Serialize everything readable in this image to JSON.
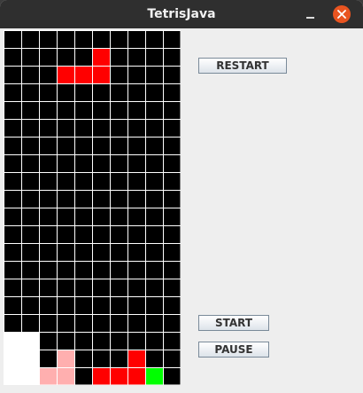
{
  "window": {
    "title": "TetrisJava"
  },
  "buttons": {
    "restart": "RESTART",
    "start": "START",
    "pause": "PAUSE"
  },
  "board": {
    "columns": 10,
    "rows": 20,
    "empty_color": "#000000",
    "grid_color": "#ffffff",
    "cells": [
      {
        "col": 5,
        "row": 1,
        "color": "#ff0000"
      },
      {
        "col": 3,
        "row": 2,
        "color": "#ff0000"
      },
      {
        "col": 4,
        "row": 2,
        "color": "#ff0000"
      },
      {
        "col": 5,
        "row": 2,
        "color": "#ff0000"
      },
      {
        "col": 0,
        "row": 17,
        "color": "#ffffff"
      },
      {
        "col": 1,
        "row": 17,
        "color": "#ffffff"
      },
      {
        "col": 0,
        "row": 18,
        "color": "#ffffff"
      },
      {
        "col": 1,
        "row": 18,
        "color": "#ffffff"
      },
      {
        "col": 3,
        "row": 18,
        "color": "#ffafaf"
      },
      {
        "col": 7,
        "row": 18,
        "color": "#ff0000"
      },
      {
        "col": 0,
        "row": 19,
        "color": "#ffffff"
      },
      {
        "col": 1,
        "row": 19,
        "color": "#ffffff"
      },
      {
        "col": 2,
        "row": 19,
        "color": "#ffafaf"
      },
      {
        "col": 3,
        "row": 19,
        "color": "#ffafaf"
      },
      {
        "col": 5,
        "row": 19,
        "color": "#ff0000"
      },
      {
        "col": 6,
        "row": 19,
        "color": "#ff0000"
      },
      {
        "col": 7,
        "row": 19,
        "color": "#ff0000"
      },
      {
        "col": 8,
        "row": 19,
        "color": "#00ff00"
      }
    ]
  }
}
